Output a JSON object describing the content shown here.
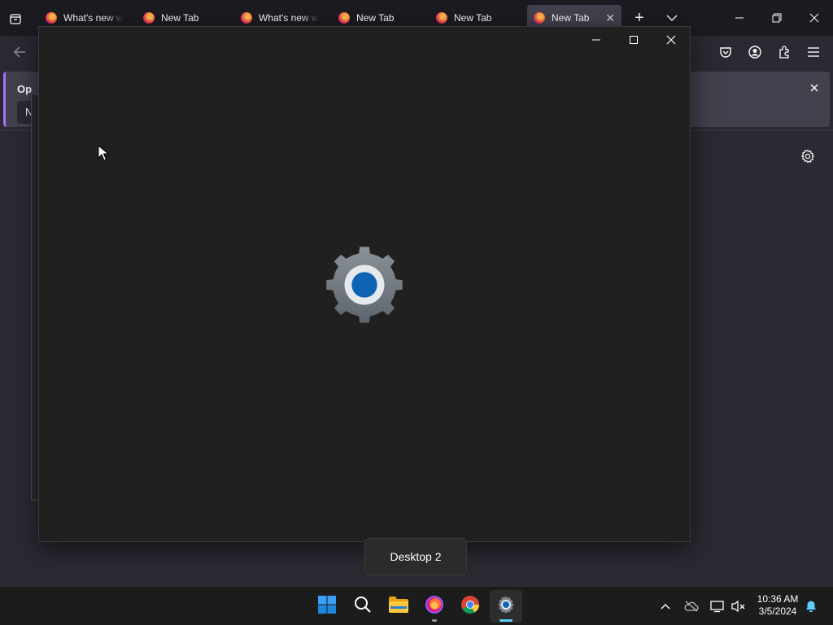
{
  "firefox": {
    "tabs": [
      {
        "title": "What's new w"
      },
      {
        "title": "New Tab"
      },
      {
        "title": "What's new w"
      },
      {
        "title": "New Tab"
      },
      {
        "title": "New Tab"
      },
      {
        "title": "New Tab",
        "active": true
      }
    ],
    "new_tab_glyph": "+",
    "notice": {
      "title": "Op",
      "button_label": "N"
    }
  },
  "desktop_tooltip": "Desktop 2",
  "taskbar": {
    "apps": [
      "start",
      "search",
      "file-explorer",
      "firefox",
      "chrome",
      "settings"
    ],
    "active_app": "settings",
    "clock": {
      "time": "10:36 AM",
      "date": "3/5/2024"
    }
  },
  "colors": {
    "accent": "#0067c0",
    "settings_indicator": "#60cdff",
    "notice_accent": "#a970ff"
  }
}
